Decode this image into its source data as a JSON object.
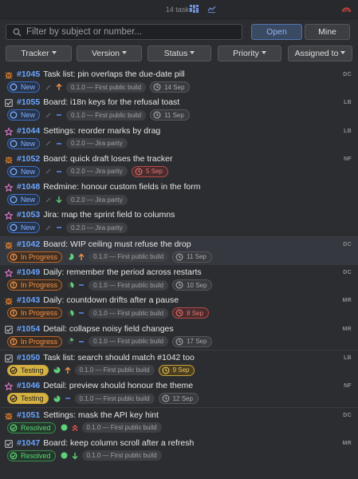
{
  "header": {
    "task_count": "14 tasks"
  },
  "search": {
    "placeholder": "Filter by subject or number...",
    "open_label": "Open",
    "mine_label": "Mine"
  },
  "filters": [
    "Tracker",
    "Version",
    "Status",
    "Priority",
    "Assigned to"
  ],
  "colors": {
    "accent": "#6aa5ff",
    "new": "#4a8cff",
    "in_progress": "#f0934a",
    "testing": "#d6b242",
    "resolved": "#5fd17a",
    "overdue": "#e67474"
  },
  "tasks": [
    {
      "num": "#1045",
      "subject": "Task list: pin overlaps the due-date pill",
      "type": "bug",
      "status": "New",
      "status_class": "new",
      "progress": 0,
      "priority": "high",
      "version": "0.1.0 — First public build",
      "due": "14 Sep",
      "due_state": "normal",
      "assignee": "DC"
    },
    {
      "num": "#1055",
      "subject": "Board: i18n keys for the refusal toast",
      "type": "task",
      "status": "New",
      "status_class": "new",
      "progress": 0,
      "priority": "normal",
      "version": "0.1.0 — First public build",
      "due": "11 Sep",
      "due_state": "normal",
      "assignee": "LB"
    },
    {
      "num": "#1044",
      "subject": "Settings: reorder marks by drag",
      "type": "feature",
      "status": "New",
      "status_class": "new",
      "progress": 0,
      "priority": "normal",
      "version": "0.2.0 — Jira parity",
      "due": "",
      "due_state": "none",
      "assignee": "LB"
    },
    {
      "num": "#1052",
      "subject": "Board: quick draft loses the tracker",
      "type": "bug",
      "status": "New",
      "status_class": "new",
      "progress": 0,
      "priority": "normal",
      "version": "0.2.0 — Jira parity",
      "due": "5 Sep",
      "due_state": "overdue",
      "assignee": "NF"
    },
    {
      "num": "#1048",
      "subject": "Redmine: honour custom fields in the form",
      "type": "feature",
      "status": "New",
      "status_class": "new",
      "progress": 0,
      "priority": "low",
      "version": "0.2.0 — Jira parity",
      "due": "",
      "due_state": "none",
      "assignee": ""
    },
    {
      "num": "#1053",
      "subject": "Jira: map the sprint field to columns",
      "type": "feature",
      "status": "New",
      "status_class": "new",
      "progress": 0,
      "priority": "normal",
      "version": "0.2.0 — Jira parity",
      "due": "",
      "due_state": "none",
      "assignee": ""
    },
    {
      "num": "#1042",
      "subject": "Board: WIP ceiling must refuse the drop",
      "type": "bug",
      "status": "In Progress",
      "status_class": "progress",
      "progress": 0.6,
      "priority": "high",
      "version": "0.1.0 — First public build",
      "due": "11 Sep",
      "due_state": "normal",
      "assignee": "DC",
      "selected": true
    },
    {
      "num": "#1049",
      "subject": "Daily: remember the period across restarts",
      "type": "feature",
      "status": "In Progress",
      "status_class": "progress",
      "progress": 0.4,
      "priority": "normal",
      "version": "0.1.0 — First public build",
      "due": "10 Sep",
      "due_state": "normal",
      "assignee": "DC"
    },
    {
      "num": "#1043",
      "subject": "Daily: countdown drifts after a pause",
      "type": "bug",
      "status": "In Progress",
      "status_class": "progress",
      "progress": 0.4,
      "priority": "normal",
      "version": "0.1.0 — First public build",
      "due": "8 Sep",
      "due_state": "overdue",
      "assignee": "MR"
    },
    {
      "num": "#1054",
      "subject": "Detail: collapse noisy field changes",
      "type": "task",
      "status": "In Progress",
      "status_class": "progress",
      "progress": 0.2,
      "priority": "normal",
      "version": "0.1.0 — First public build",
      "due": "17 Sep",
      "due_state": "normal",
      "assignee": "MR"
    },
    {
      "num": "#1050",
      "subject": "Task list: search should match #1042 too",
      "type": "task",
      "status": "Testing",
      "status_class": "testing",
      "progress": 0.8,
      "priority": "high",
      "version": "0.1.0 — First public build",
      "due": "9 Sep",
      "due_state": "soon",
      "assignee": "LB"
    },
    {
      "num": "#1046",
      "subject": "Detail: preview should honour the theme",
      "type": "feature",
      "status": "Testing",
      "status_class": "testing",
      "progress": 0.8,
      "priority": "normal",
      "version": "0.1.0 — First public build",
      "due": "12 Sep",
      "due_state": "normal",
      "assignee": "NF"
    },
    {
      "num": "#1051",
      "subject": "Settings: mask the API key hint",
      "type": "bug",
      "status": "Resolved",
      "status_class": "resolved",
      "progress": 1,
      "priority": "urgent",
      "version": "0.1.0 — First public build",
      "due": "",
      "due_state": "none",
      "assignee": "DC"
    },
    {
      "num": "#1047",
      "subject": "Board: keep column scroll after a refresh",
      "type": "task",
      "status": "Resolved",
      "status_class": "resolved",
      "progress": 1,
      "priority": "low",
      "version": "0.1.0 — First public build",
      "due": "",
      "due_state": "none",
      "assignee": "MR"
    }
  ]
}
